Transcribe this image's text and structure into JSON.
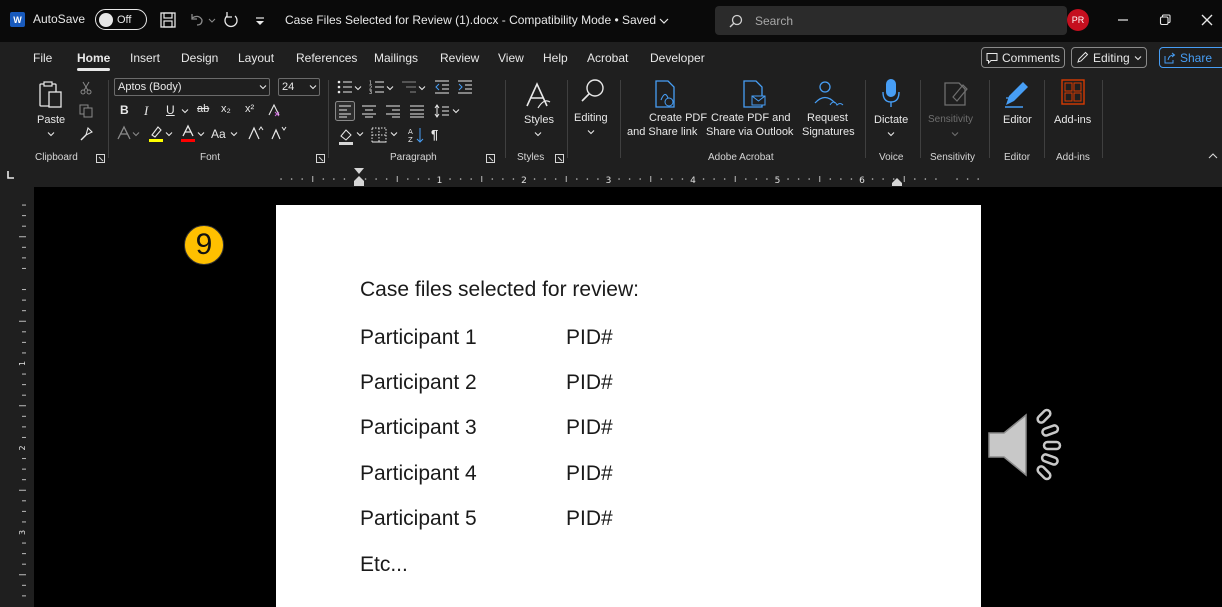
{
  "titlebar": {
    "autosave_label": "AutoSave",
    "autosave_state": "Off",
    "document_title": "Case Files Selected for Review (1).docx  -  Compatibility Mode • Saved",
    "search_placeholder": "Search",
    "user_initials": "PR"
  },
  "menu": {
    "tabs": [
      "File",
      "Home",
      "Insert",
      "Design",
      "Layout",
      "References",
      "Mailings",
      "Review",
      "View",
      "Help",
      "Acrobat",
      "Developer"
    ],
    "active_tab": "Home",
    "comments_label": "Comments",
    "editing_label": "Editing",
    "share_label": "Share"
  },
  "ribbon": {
    "clipboard": {
      "paste_label": "Paste",
      "group_label": "Clipboard"
    },
    "font": {
      "font_name": "Aptos (Body)",
      "font_size": "24",
      "group_label": "Font",
      "bold": "B",
      "italic": "I",
      "underline": "U",
      "strikethrough": "ab",
      "subscript": "x₂",
      "superscript": "x²",
      "change_case": "Aa"
    },
    "paragraph": {
      "group_label": "Paragraph"
    },
    "styles": {
      "label": "Styles",
      "group_label": "Styles"
    },
    "editing": {
      "label": "Editing"
    },
    "acrobat": {
      "create_pdf_line1": "Create PDF",
      "create_pdf_line2": "and Share link",
      "share_outlook_line1": "Create PDF and",
      "share_outlook_line2": "Share via Outlook",
      "request_sig_line1": "Request",
      "request_sig_line2": "Signatures",
      "group_label": "Adobe Acrobat"
    },
    "voice": {
      "label": "Dictate",
      "group_label": "Voice"
    },
    "sensitivity": {
      "label": "Sensitivity",
      "group_label": "Sensitivity"
    },
    "editor": {
      "label": "Editor",
      "group_label": "Editor"
    },
    "addins": {
      "label": "Add-ins",
      "group_label": "Add-ins"
    }
  },
  "ruler": {
    "h_numbers": [
      "1",
      "2",
      "3",
      "4",
      "5",
      "6"
    ],
    "v_numbers": [
      "1",
      "2",
      "3"
    ]
  },
  "document": {
    "slide_number": "9",
    "heading": "Case files selected for review:",
    "rows": [
      {
        "participant": "Participant 1",
        "pid": "PID#"
      },
      {
        "participant": "Participant 2",
        "pid": "PID#"
      },
      {
        "participant": "Participant 3",
        "pid": "PID#"
      },
      {
        "participant": "Participant 4",
        "pid": "PID#"
      },
      {
        "participant": "Participant 5",
        "pid": "PID#"
      }
    ],
    "footer_line": "Etc..."
  },
  "colors": {
    "word_blue": "#185abd",
    "accent_blue": "#479ef5",
    "avatar_red": "#c50f1f",
    "badge_yellow": "#ffc000",
    "addins_orange": "#d83b01"
  }
}
